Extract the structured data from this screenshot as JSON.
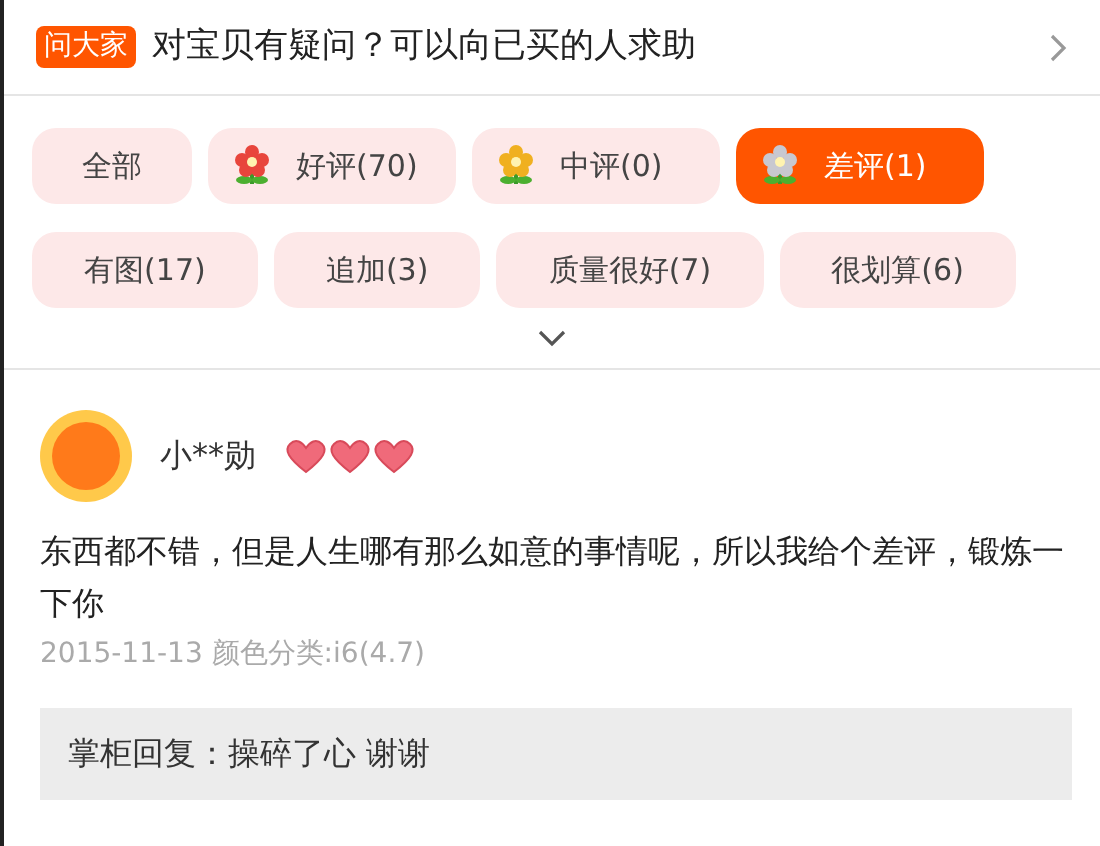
{
  "ask_bar": {
    "badge": "问大家",
    "text": "对宝贝有疑问？可以向已买的人求助"
  },
  "filters": [
    {
      "label": "全部",
      "selected": false
    },
    {
      "label": "好评(70)",
      "selected": false,
      "color": "#e8453c"
    },
    {
      "label": "中评(0)",
      "selected": false,
      "color": "#f0b020"
    },
    {
      "label": "差评(1)",
      "selected": true,
      "color": "#c8c8d0"
    },
    {
      "label": "有图(17)",
      "selected": false
    },
    {
      "label": "追加(3)",
      "selected": false
    },
    {
      "label": "质量很好(7)",
      "selected": false
    },
    {
      "label": "很划算(6)",
      "selected": false
    }
  ],
  "review": {
    "user": "小**勋",
    "stars": 3,
    "text": "东西都不错，但是人生哪有那么如意的事情呢，所以我给个差评，锻炼一下你",
    "meta": "2015-11-13 颜色分类:i6(4.7)",
    "reply": "掌柜回复：操碎了心 谢谢"
  }
}
